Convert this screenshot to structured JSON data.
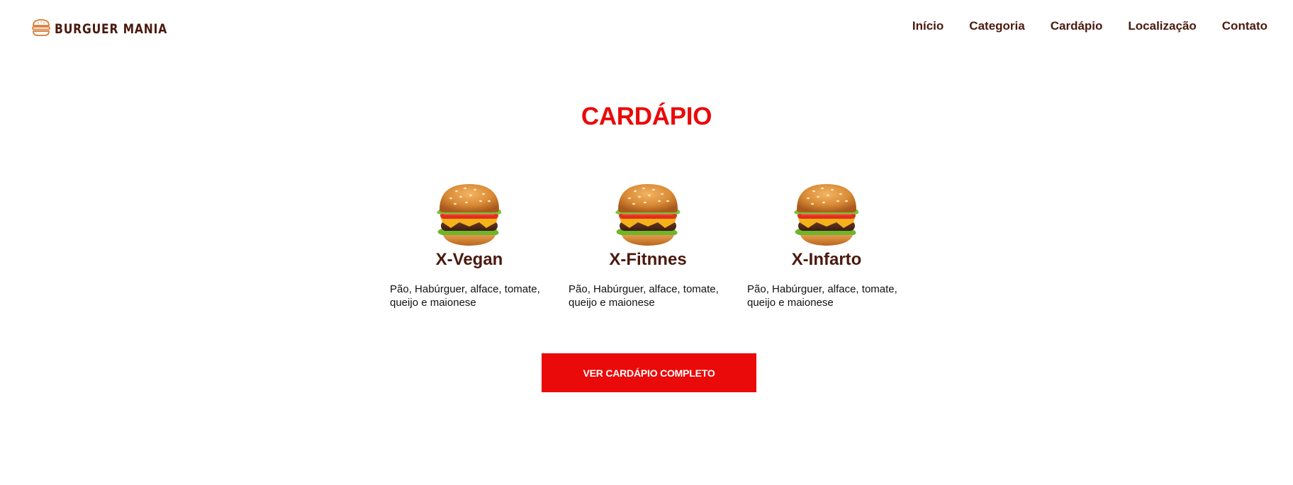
{
  "header": {
    "logo_text": "BURGUER MANIA",
    "logo_icon": "burger-icon",
    "nav": [
      {
        "label": "Início"
      },
      {
        "label": "Categoria"
      },
      {
        "label": "Cardápio"
      },
      {
        "label": "Localização"
      },
      {
        "label": "Contato"
      }
    ]
  },
  "menu": {
    "title": "CARDÁPIO",
    "items": [
      {
        "name": "X-Vegan",
        "description": "Pão, Habúrguer, alface, tomate, queijo e maionese",
        "image": "burger-image"
      },
      {
        "name": "X-Fitnnes",
        "description": "Pão, Habúrguer, alface, tomate, queijo e maionese",
        "image": "burger-image"
      },
      {
        "name": "X-Infarto",
        "description": "Pão, Habúrguer, alface, tomate, queijo e maionese",
        "image": "burger-image"
      }
    ],
    "cta_label": "VER CARDÁPIO COMPLETO"
  },
  "colors": {
    "accent": "#ea0a0a",
    "brand_dark": "#4a1a0f",
    "text": "#111111",
    "background": "#ffffff"
  }
}
